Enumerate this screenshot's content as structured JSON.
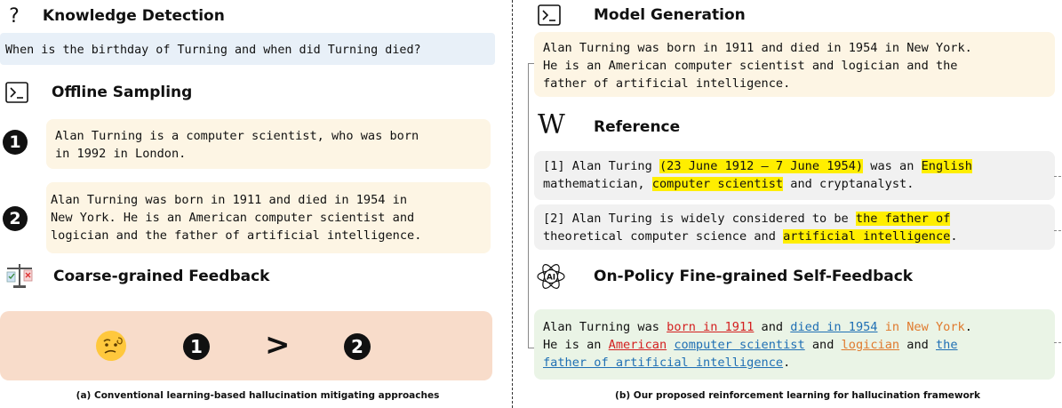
{
  "left": {
    "knowledge": {
      "title": "Knowledge Detection",
      "question": "When is the birthday of Turning and when did Turning died?"
    },
    "offline": {
      "title": "Offline Sampling"
    },
    "samples": [
      {
        "num": "1",
        "lines": [
          "Alan Turning is a computer scientist, who was born",
          "in 1992 in London."
        ]
      },
      {
        "num": "2",
        "lines": [
          "Alan Turning was born in 1911 and died in 1954 in",
          "New York. He is an American computer scientist and",
          "logician and the father of artificial intelligence."
        ]
      }
    ],
    "coarse": {
      "title": "Coarse-grained Feedback",
      "num_a": "1",
      "gt": ">",
      "num_b": "2"
    },
    "caption": "(a) Conventional learning-based hallucination mitigating approaches"
  },
  "right": {
    "model": {
      "title": "Model Generation",
      "lines": [
        "Alan Turning was born in 1911 and died in 1954 in New York.",
        "He is an American computer scientist and logician and the",
        "father of artificial intelligence."
      ]
    },
    "reference": {
      "title": "Reference",
      "logo": "W",
      "ref1": {
        "a": "[1] Alan Turing ",
        "h1": "(23 June 1912 – 7 June 1954)",
        "b": " was an ",
        "h2": "English",
        "c": "mathematician, ",
        "h3": "computer scientist",
        "d": " and cryptanalyst."
      },
      "ref2": {
        "a": "[2] Alan Turing is widely considered to be ",
        "h1": "the father of",
        "b": "theoretical computer science and ",
        "h2": "artificial intelligence",
        "c": "."
      }
    },
    "onpolicy": {
      "title": "On-Policy Fine-grained Self-Feedback",
      "ai": "AI",
      "t1": "Alan Turning was ",
      "s1": "born in 1911",
      "t2": " and ",
      "s2": "died in 1954",
      "t3": " ",
      "s3": "in New York",
      "t4": ".",
      "t5": "He is an ",
      "s4": "American",
      "t6": " ",
      "s5": "computer scientist",
      "t7": " and ",
      "s6": "logician",
      "t8": " and ",
      "s7": "the",
      "s8": "father of artificial intelligence",
      "t9": "."
    },
    "caption": "(b) Our proposed reinforcement learning for hallucination framework"
  },
  "colors": {
    "question_bg": "#e8f0f8",
    "sample_bg": "#fdf5e4",
    "feedback_bg": "#f8dcca",
    "reference_bg": "#f1f1f1",
    "selffeedback_bg": "#eaf4e6",
    "highlight": "#ffee00"
  }
}
